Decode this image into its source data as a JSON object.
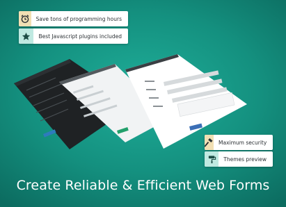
{
  "badges": [
    {
      "label": "Save tons of programming hours",
      "icon": "alarm-clock-icon"
    },
    {
      "label": "Best Javascript plugins included",
      "icon": "star-icon"
    },
    {
      "label": "Maximum security",
      "icon": "hammer-icon"
    },
    {
      "label": "Themes preview",
      "icon": "paint-roller-icon"
    }
  ],
  "headline": "Create Reliable & Efficient Web Forms",
  "colors": {
    "background": "#14907f",
    "badge_tan": "#f1dfb3",
    "badge_teal": "#bfe9e1",
    "accent_blue": "#3b6fb6",
    "accent_green": "#22a06b"
  }
}
